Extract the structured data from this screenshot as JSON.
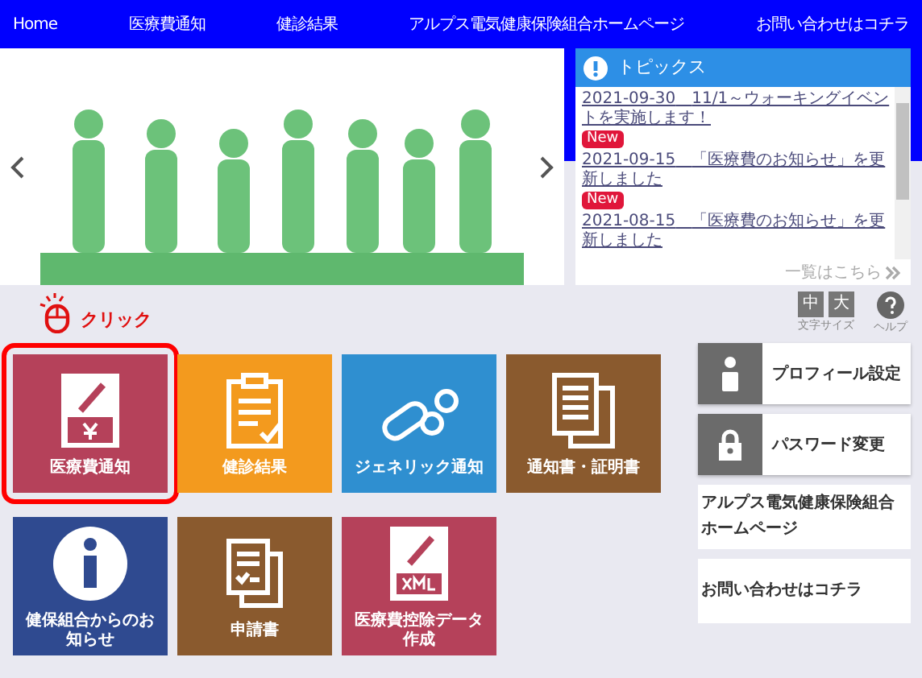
{
  "nav": {
    "items": [
      {
        "label": "Home"
      },
      {
        "label": "医療費通知"
      },
      {
        "label": "健診結果"
      },
      {
        "label": "アルプス電気健康保険組合ホームページ"
      },
      {
        "label": "お問い合わせはコチラ"
      }
    ]
  },
  "topics": {
    "title": "トピックス",
    "items": [
      {
        "date": "2021-09-30",
        "text": "11/1～ウォーキングイベントを実施します！",
        "badge": "New"
      },
      {
        "date": "2021-09-15",
        "text": "「医療費のお知らせ」を更新しました",
        "badge": "New"
      },
      {
        "date": "2021-08-15",
        "text": "「医療費のお知らせ」を更新しました"
      }
    ],
    "more": "一覧はこちら"
  },
  "click_hint": {
    "label": "クリック"
  },
  "text_size": {
    "buttons": [
      {
        "label": "中"
      },
      {
        "label": "大"
      }
    ],
    "caption": "文字サイズ",
    "help": "ヘルプ"
  },
  "tiles": [
    {
      "label": "医療費通知",
      "kind": "bill",
      "color": "#b5415a",
      "highlighted": true
    },
    {
      "label": "健診結果",
      "kind": "clipboard",
      "color": "#f39a1e",
      "highlighted": false
    },
    {
      "label": "ジェネリック通知",
      "kind": "pills",
      "color": "#2f8fd0",
      "highlighted": false
    },
    {
      "label": "通知書・証明書",
      "kind": "documents",
      "color": "#8a5a2e",
      "highlighted": false
    },
    {
      "label": "健保組合からのお知らせ",
      "kind": "info",
      "color": "#2f4a90",
      "highlighted": false
    },
    {
      "label": "申請書",
      "kind": "form",
      "color": "#8a5a2e",
      "highlighted": false
    },
    {
      "label": "医療費控除データ作成",
      "kind": "xml",
      "color": "#b5415a",
      "highlighted": false
    }
  ],
  "side_buttons": [
    {
      "label": "プロフィール設定",
      "kind": "icon"
    },
    {
      "label": "パスワード変更",
      "kind": "icon"
    },
    {
      "label": "アルプス電気健康保険組合ホームページ",
      "kind": "plain"
    },
    {
      "label": "お問い合わせはコチラ",
      "kind": "plain"
    }
  ]
}
